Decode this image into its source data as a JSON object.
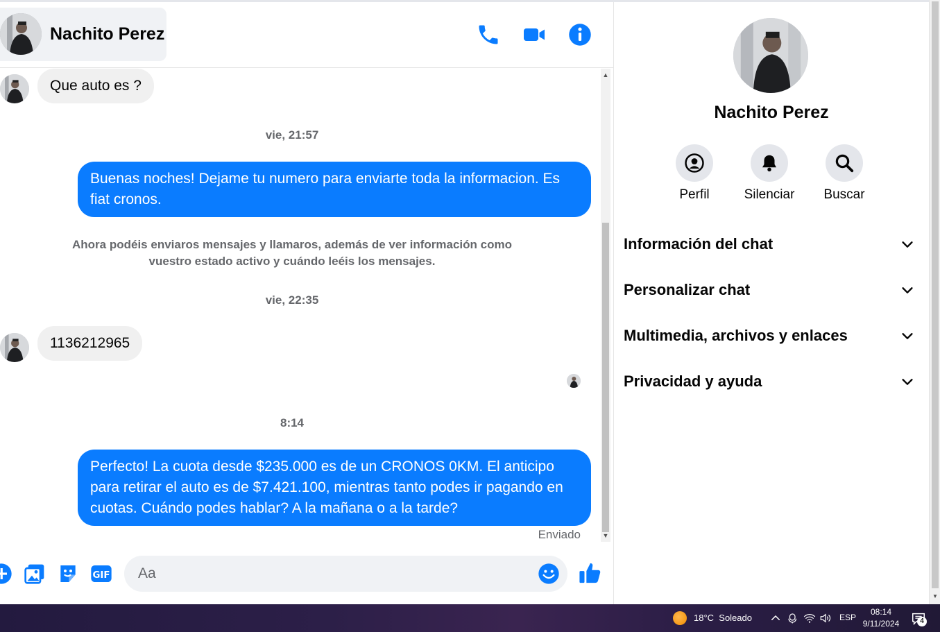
{
  "contact": {
    "name": "Nachito Perez"
  },
  "conversation": {
    "msg_1_in": "Que auto es ?",
    "time_1": "vie, 21:57",
    "msg_2_out": "Buenas noches! Dejame tu numero para enviarte toda la informacion. Es fiat cronos.",
    "system_note": "Ahora podéis enviaros mensajes y llamaros, además de ver información como vuestro estado activo y cuándo leéis los mensajes.",
    "time_2": "vie, 22:35",
    "msg_3_in": "1136212965",
    "time_3": "8:14",
    "msg_4_out": "Perfecto! La cuota desde $235.000 es de un CRONOS 0KM. El anticipo para retirar el auto es de $7.421.100, mientras tanto podes ir pagando en cuotas. Cuándo podes hablar? A la mañana o a la tarde?",
    "status": "Enviado"
  },
  "composer": {
    "placeholder": "Aa"
  },
  "info_panel": {
    "name": "Nachito Perez",
    "actions": [
      {
        "label": "Perfil",
        "icon": "profile-icon"
      },
      {
        "label": "Silenciar",
        "icon": "bell-icon"
      },
      {
        "label": "Buscar",
        "icon": "search-icon"
      }
    ],
    "sections": [
      {
        "label": "Información del chat"
      },
      {
        "label": "Personalizar chat"
      },
      {
        "label": "Multimedia, archivos y enlaces"
      },
      {
        "label": "Privacidad y ayuda"
      }
    ]
  },
  "taskbar": {
    "weather": "18°C  Soleado",
    "language": "ESP",
    "time": "08:14",
    "date": "9/11/2024",
    "notification_count": "4"
  },
  "colors": {
    "accent": "#0a7cff",
    "incoming_bubble": "#f0f0f0"
  }
}
